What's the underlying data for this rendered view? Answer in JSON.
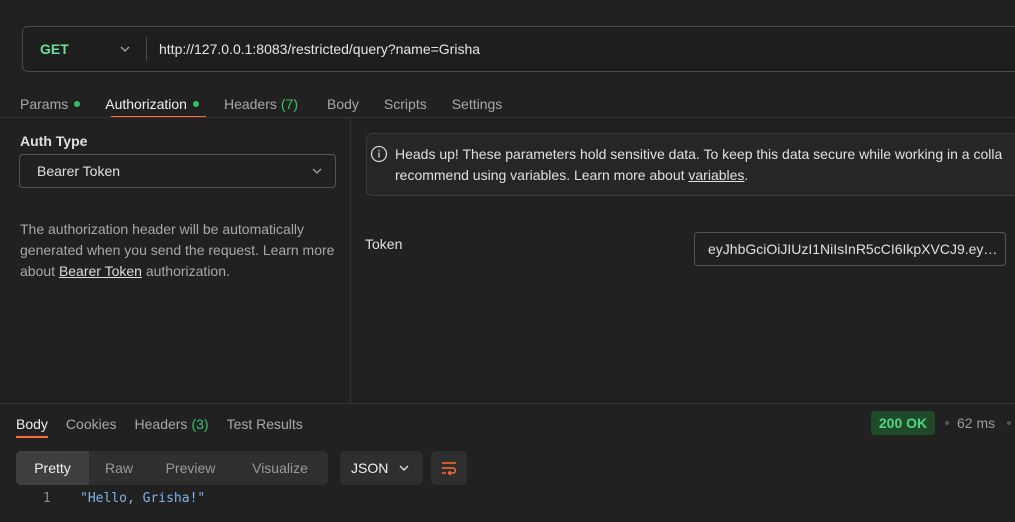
{
  "request": {
    "method": "GET",
    "url": "http://127.0.0.1:8083/restricted/query?name=Grisha"
  },
  "tabs": [
    {
      "label": "Params"
    },
    {
      "label": "Authorization"
    },
    {
      "label": "Headers",
      "count": "(7)"
    },
    {
      "label": "Body"
    },
    {
      "label": "Scripts"
    },
    {
      "label": "Settings"
    }
  ],
  "auth": {
    "type_label": "Auth Type",
    "type_value": "Bearer Token",
    "desc_part1": "The authorization header will be automatically generated when you send the request. Learn more about ",
    "desc_link": "Bearer Token",
    "desc_part2": " authorization."
  },
  "notice": {
    "line1": "Heads up! These parameters hold sensitive data. To keep this data secure while working in a colla",
    "line2_pre": "recommend using variables. Learn more about ",
    "line2_link": "variables",
    "line2_post": "."
  },
  "token": {
    "label": "Token",
    "value": "eyJhbGciOiJIUzI1NiIsInR5cCI6IkpXVCJ9.ey…"
  },
  "response": {
    "tabs": [
      {
        "label": "Body"
      },
      {
        "label": "Cookies"
      },
      {
        "label": "Headers",
        "count": "(3)"
      },
      {
        "label": "Test Results"
      }
    ],
    "status": "200 OK",
    "time": "62 ms",
    "view_modes": [
      "Pretty",
      "Raw",
      "Preview",
      "Visualize"
    ],
    "format": "JSON",
    "lines": [
      {
        "num": "1",
        "text": "\"Hello, Grisha!\""
      }
    ]
  },
  "colors": {
    "accent": "#ff6c37",
    "success": "#33c46b",
    "method": "#6bdd9a"
  }
}
